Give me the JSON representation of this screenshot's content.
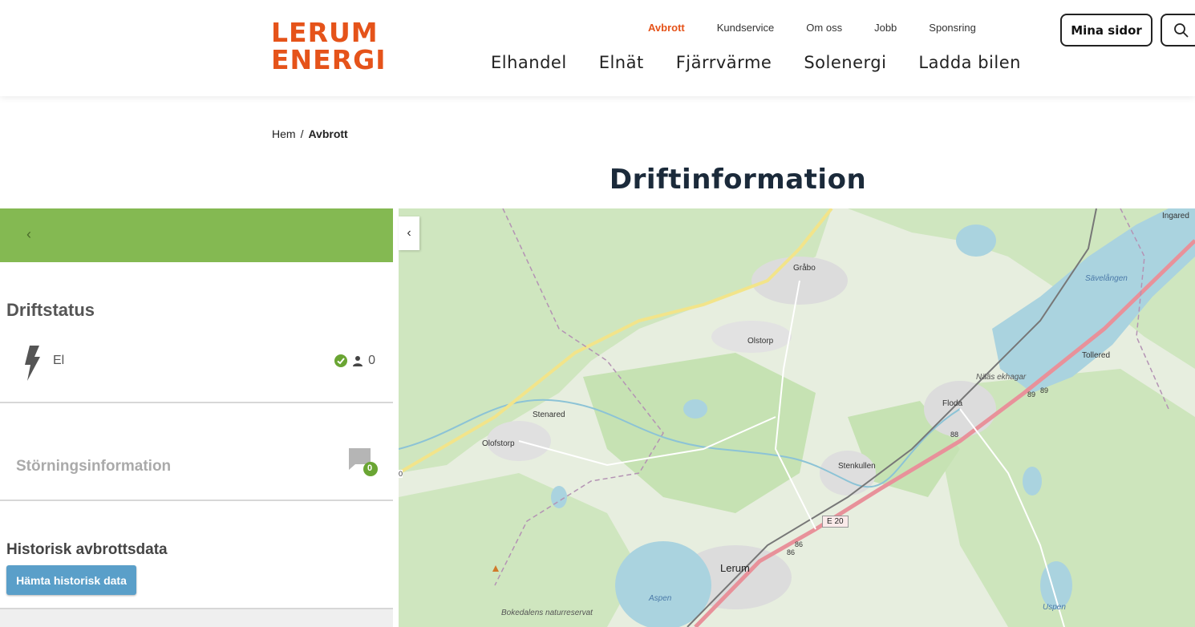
{
  "brand": {
    "line1": "LERUM",
    "line2": "ENERGI",
    "color": "#e5531a"
  },
  "topnav": [
    {
      "label": "Avbrott",
      "active": true
    },
    {
      "label": "Kundservice"
    },
    {
      "label": "Om oss"
    },
    {
      "label": "Jobb"
    },
    {
      "label": "Sponsring"
    }
  ],
  "mainnav": [
    {
      "label": "Elhandel"
    },
    {
      "label": "Elnät"
    },
    {
      "label": "Fjärrvärme"
    },
    {
      "label": "Solenergi"
    },
    {
      "label": "Ladda bilen"
    }
  ],
  "header": {
    "mina_sidor": "Mina sidor",
    "search_icon": "search-icon"
  },
  "breadcrumb": {
    "home": "Hem",
    "separator": "/",
    "current": "Avbrott"
  },
  "page": {
    "title": "Driftinformation"
  },
  "panel": {
    "back_icon": "chevron-left-icon",
    "status_title": "Driftstatus",
    "el_label": "El",
    "el_affected": "0",
    "disturbance_title": "Störningsinformation",
    "disturbance_count": "0",
    "history_title": "Historisk avbrottsdata",
    "history_button": "Hämta historisk data",
    "header_color": "#84b952"
  },
  "map": {
    "places": [
      "Ingared",
      "Gråbo",
      "Sävelången",
      "Olstorp",
      "Tollered",
      "Nääs ekhagar",
      "Floda",
      "Stenared",
      "Olofstorp",
      "Stenkullen",
      "Lerum",
      "Aspen",
      "Bokedalens naturreservat",
      "Uspen"
    ],
    "road_sign": "E 20",
    "road_numbers": [
      "89",
      "89",
      "88",
      "86",
      "86"
    ],
    "edge_label": "0"
  }
}
